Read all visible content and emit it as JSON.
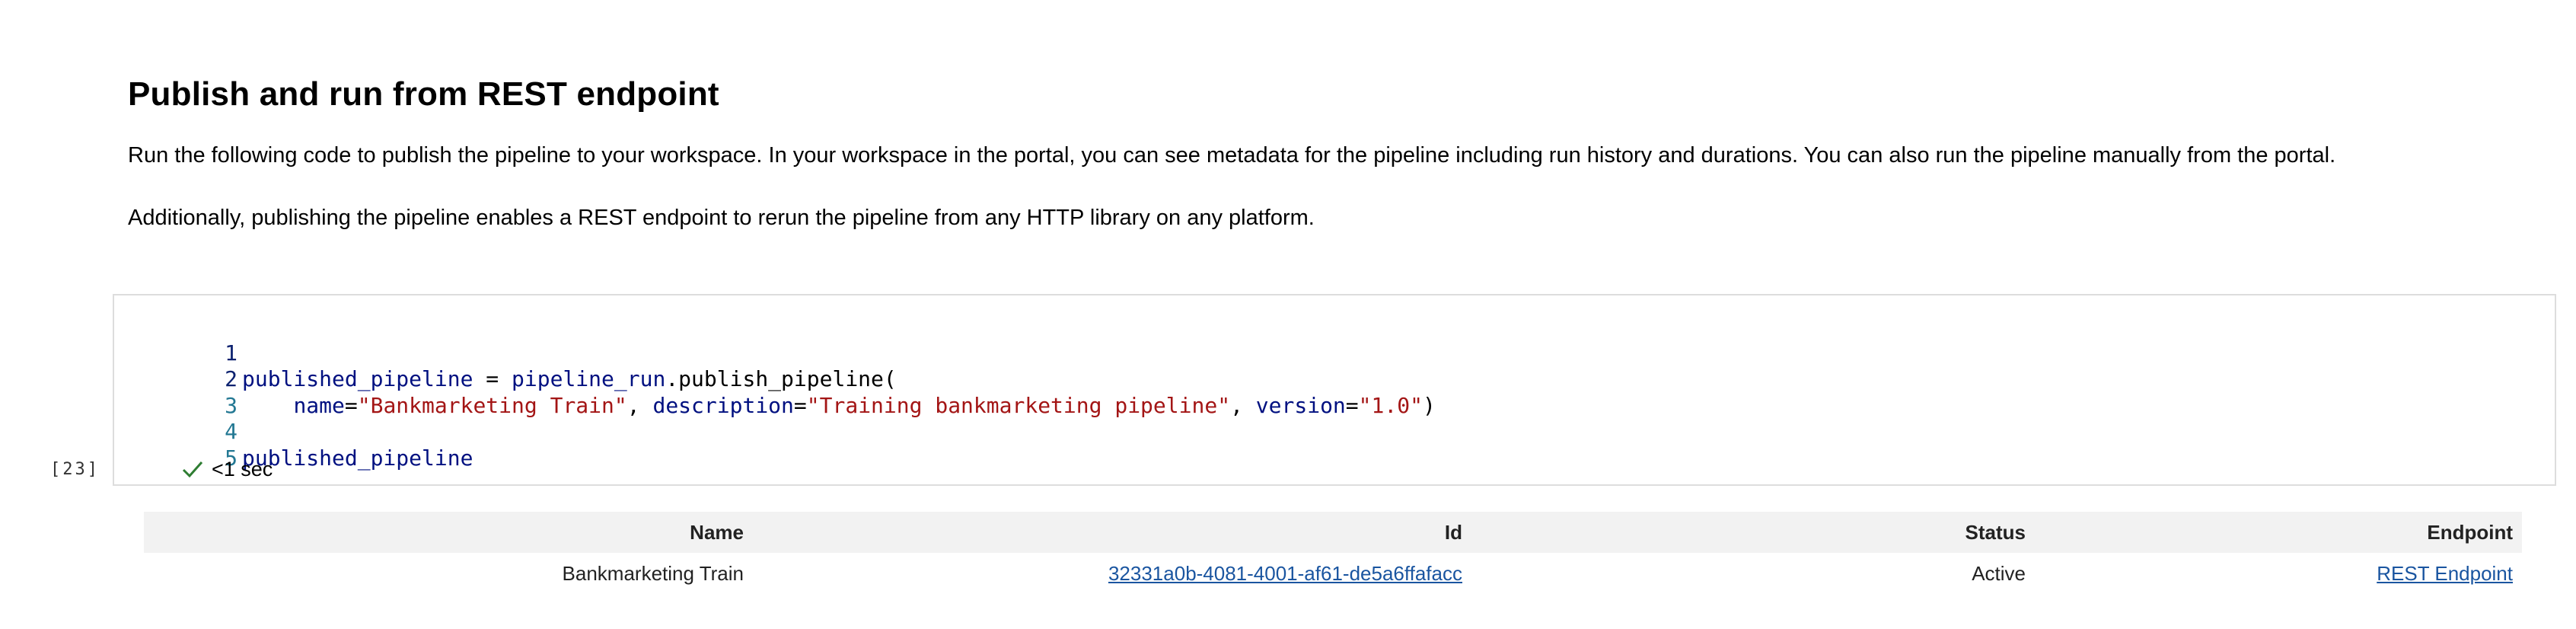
{
  "markdown": {
    "title": "Publish and run from REST endpoint",
    "paragraph_1": "Run the following code to publish the pipeline to your workspace. In your workspace in the portal, you can see metadata for the pipeline including run history and durations. You can also run the pipeline manually from the portal.",
    "paragraph_2": "Additionally, publishing the pipeline enables a REST endpoint to rerun the pipeline from any HTTP library on any platform."
  },
  "code_cell": {
    "execution_count": "[23]",
    "status_icon": "check-icon",
    "status_text": "<1 sec",
    "lines": [
      {
        "number": "1",
        "tokens": [
          {
            "t": "published_pipeline",
            "k": "var"
          },
          {
            "t": " = ",
            "k": "plain"
          },
          {
            "t": "pipeline_run",
            "k": "var"
          },
          {
            "t": ".publish_pipeline(",
            "k": "plain"
          }
        ]
      },
      {
        "number": "2",
        "tokens": [
          {
            "t": "    ",
            "k": "plain"
          },
          {
            "t": "name",
            "k": "var"
          },
          {
            "t": "=",
            "k": "plain"
          },
          {
            "t": "\"Bankmarketing Train\"",
            "k": "str"
          },
          {
            "t": ", ",
            "k": "plain"
          },
          {
            "t": "description",
            "k": "var"
          },
          {
            "t": "=",
            "k": "plain"
          },
          {
            "t": "\"Training bankmarketing pipeline\"",
            "k": "str"
          },
          {
            "t": ", ",
            "k": "plain"
          },
          {
            "t": "version",
            "k": "var"
          },
          {
            "t": "=",
            "k": "plain"
          },
          {
            "t": "\"1.0\"",
            "k": "str"
          },
          {
            "t": ")",
            "k": "plain"
          }
        ]
      },
      {
        "number": "3",
        "tokens": []
      },
      {
        "number": "4",
        "tokens": [
          {
            "t": "published_pipeline",
            "k": "var"
          }
        ]
      },
      {
        "number": "5",
        "tokens": []
      }
    ]
  },
  "output_table": {
    "headers": {
      "name": "Name",
      "id": "Id",
      "status": "Status",
      "endpoint": "Endpoint"
    },
    "rows": [
      {
        "name": "Bankmarketing Train",
        "id": "32331a0b-4081-4001-af61-de5a6ffafacc",
        "status": "Active",
        "endpoint": "REST Endpoint"
      }
    ]
  },
  "colors": {
    "variable": "#001080",
    "string": "#a31515",
    "line_number": "#237893",
    "success_check": "#2e7d32",
    "link": "#1a55a0",
    "table_header_bg": "#f2f2f2"
  }
}
